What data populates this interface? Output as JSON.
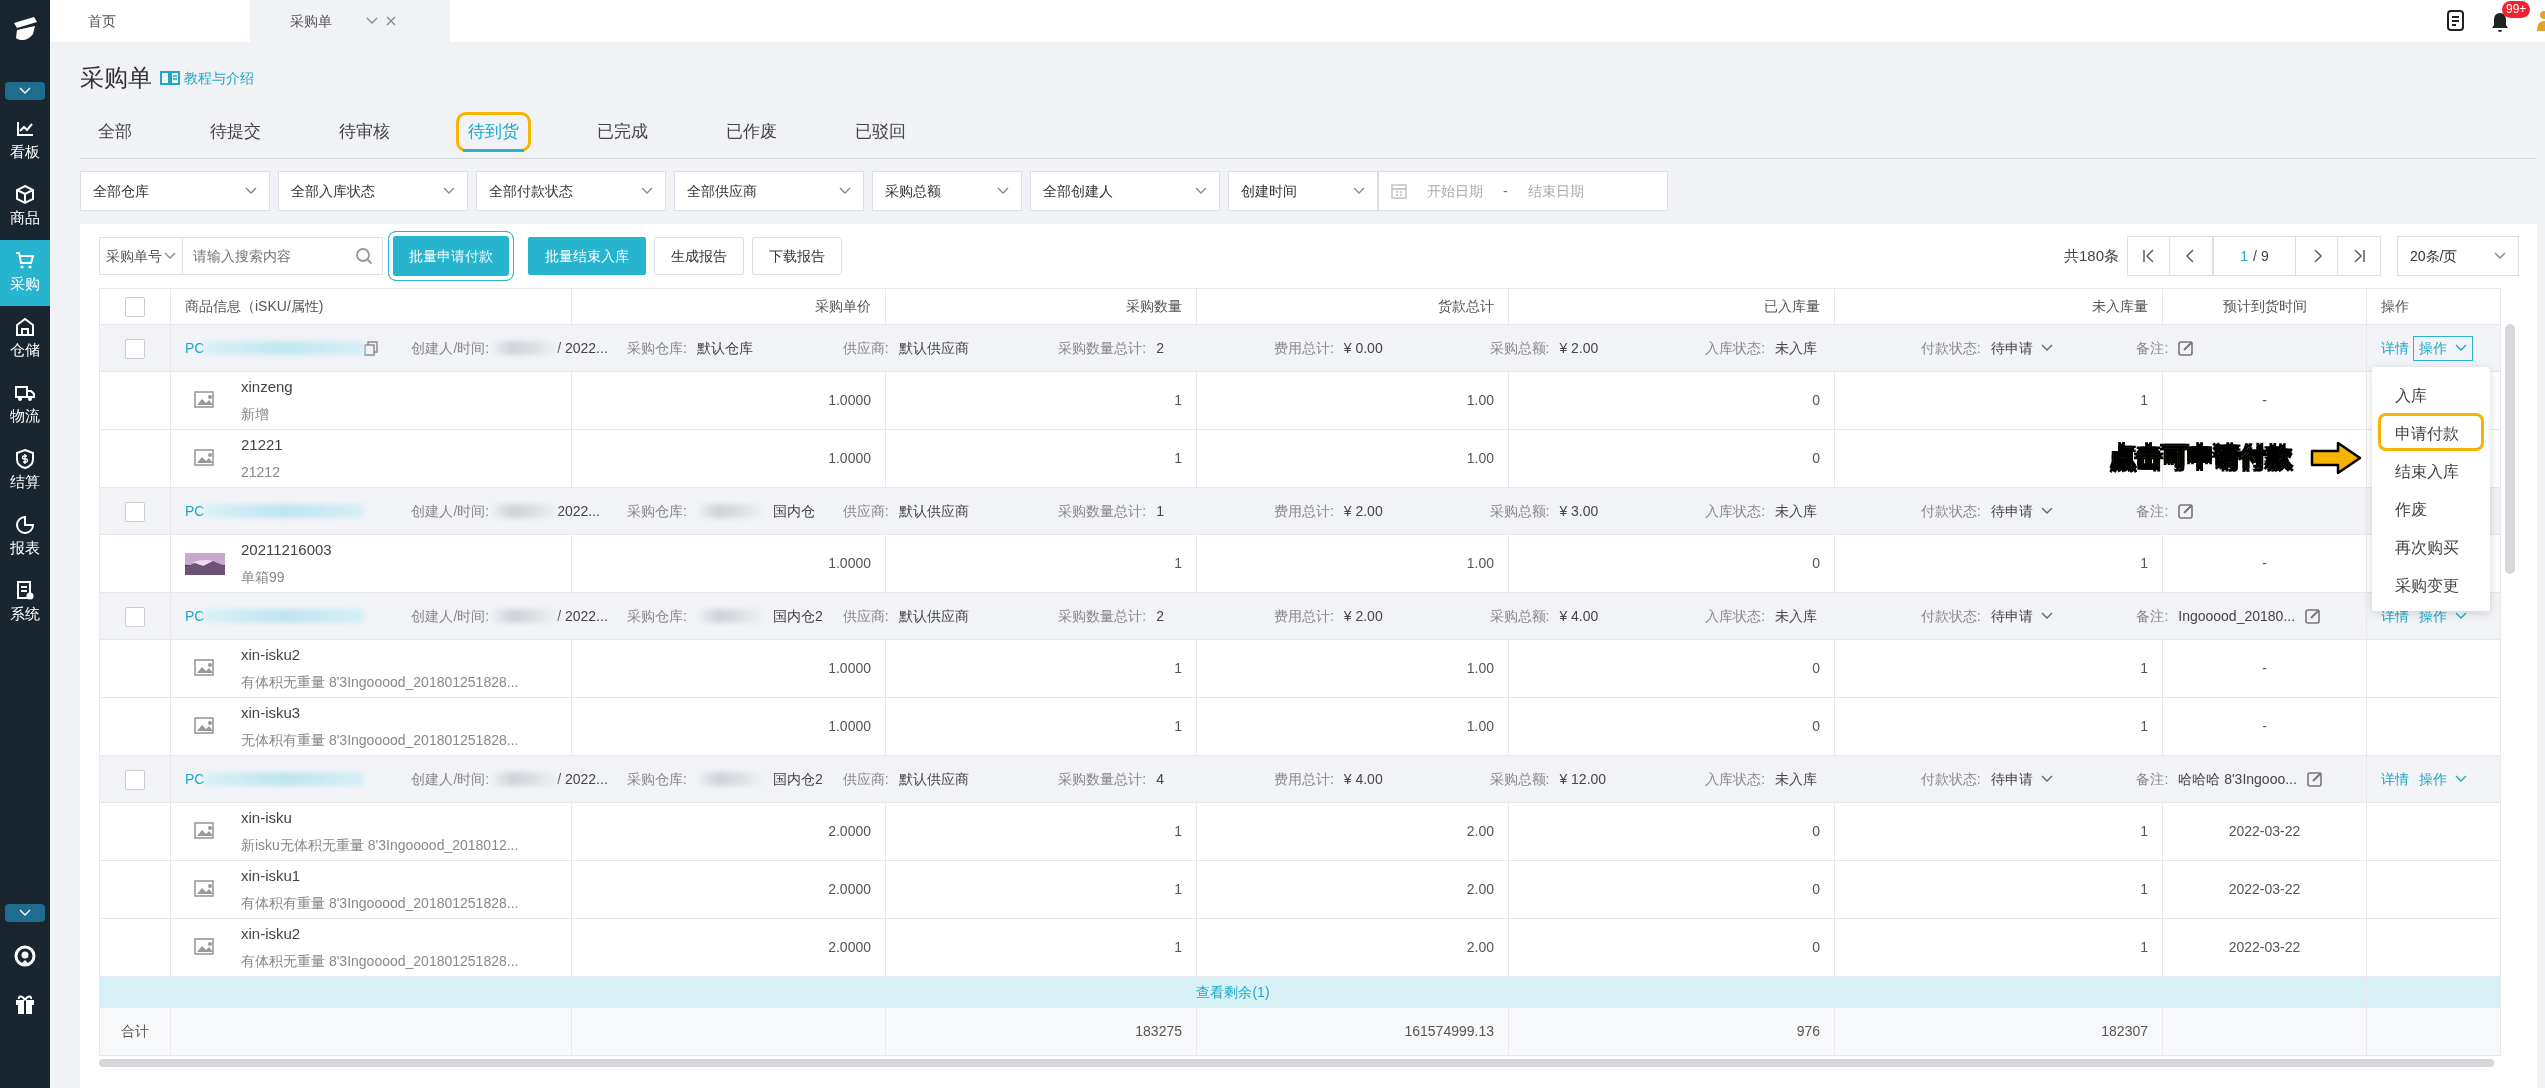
{
  "top_tabs": [
    {
      "label": "首页",
      "selected": false,
      "closable": false
    },
    {
      "label": "采购单",
      "selected": true,
      "closable": true
    }
  ],
  "header": {
    "notification_badge": "99+"
  },
  "sidebar": {
    "items": [
      {
        "label": "看板",
        "selected": false
      },
      {
        "label": "商品",
        "selected": false
      },
      {
        "label": "采购",
        "selected": true
      },
      {
        "label": "仓储",
        "selected": false
      },
      {
        "label": "物流",
        "selected": false
      },
      {
        "label": "结算",
        "selected": false
      },
      {
        "label": "报表",
        "selected": false
      },
      {
        "label": "系统",
        "selected": false
      }
    ]
  },
  "page": {
    "title": "采购单",
    "help_link": "教程与介绍"
  },
  "status_tabs": [
    {
      "label": "全部",
      "selected": false,
      "highlighted": false
    },
    {
      "label": "待提交",
      "selected": false,
      "highlighted": false
    },
    {
      "label": "待审核",
      "selected": false,
      "highlighted": false
    },
    {
      "label": "待到货",
      "selected": true,
      "highlighted": true
    },
    {
      "label": "已完成",
      "selected": false,
      "highlighted": false
    },
    {
      "label": "已作废",
      "selected": false,
      "highlighted": false
    },
    {
      "label": "已驳回",
      "selected": false,
      "highlighted": false
    }
  ],
  "filters": [
    {
      "label": "全部仓库",
      "kind": "wide"
    },
    {
      "label": "全部入库状态",
      "kind": "wide"
    },
    {
      "label": "全部付款状态",
      "kind": "wide"
    },
    {
      "label": "全部供应商",
      "kind": "wide"
    },
    {
      "label": "采购总额",
      "kind": "narrow"
    },
    {
      "label": "全部创建人",
      "kind": "wide"
    },
    {
      "label": "创建时间",
      "kind": "narrow"
    }
  ],
  "date_range": {
    "start_placeholder": "开始日期",
    "separator": "-",
    "end_placeholder": "结束日期"
  },
  "toolbar": {
    "search_type": "采购单号",
    "search_placeholder": "请输入搜索内容",
    "buttons": [
      {
        "label": "批量申请付款",
        "kind": "primary",
        "highlighted": true
      },
      {
        "label": "批量结束入库",
        "kind": "primary",
        "highlighted": false
      },
      {
        "label": "生成报告",
        "kind": "outline",
        "highlighted": false
      },
      {
        "label": "下载报告",
        "kind": "outline",
        "highlighted": false
      }
    ],
    "total": "共180条",
    "page": "1",
    "pages": "/ 9",
    "page_size": "20条/页"
  },
  "table": {
    "header_checked": false,
    "columns": [
      "商品信息（iSKU/属性)",
      "采购单价",
      "采购数量",
      "货款总计",
      "已入库量",
      "未入库量",
      "预计到货时间",
      "操作"
    ],
    "groups": [
      {
        "checked": false,
        "po": "PC",
        "show_copy": true,
        "menu_open": true,
        "fields": [
          {
            "label": "创建人/时间:",
            "value": "/ 2022...",
            "redacted": true,
            "kind": "text"
          },
          {
            "label": "采购仓库:",
            "value": "默认仓库",
            "redacted": false,
            "kind": "text"
          },
          {
            "label": "供应商:",
            "value": "默认供应商",
            "redacted": false,
            "kind": "text"
          },
          {
            "label": "采购数量总计:",
            "value": "2",
            "redacted": false,
            "kind": "text"
          },
          {
            "label": "费用总计:",
            "value": "¥ 0.00",
            "redacted": false,
            "kind": "text"
          },
          {
            "label": "采购总额:",
            "value": "¥ 2.00",
            "redacted": false,
            "kind": "text"
          },
          {
            "label": "入库状态:",
            "value": "未入库",
            "redacted": false,
            "kind": "text"
          },
          {
            "label": "付款状态:",
            "value": "待申请",
            "redacted": false,
            "kind": "dropdown"
          },
          {
            "label": "备注:",
            "redacted": false,
            "kind": "remark"
          }
        ],
        "actions": [
          {
            "label": "详情",
            "kind": "link"
          },
          {
            "label": "操作",
            "kind": "menu"
          }
        ],
        "items": [
          {
            "name": "xinzeng",
            "attribute": "新增",
            "kind": "placeholder",
            "values": [
              "1.0000",
              "1",
              "1.00",
              "0",
              "1",
              "-"
            ]
          },
          {
            "name": "21221",
            "attribute": "21212",
            "kind": "placeholder",
            "values": [
              "1.0000",
              "1",
              "1.00",
              "0"
            ]
          }
        ]
      },
      {
        "checked": false,
        "po": "PC",
        "show_copy": false,
        "fields": [
          {
            "label": "创建人/时间:",
            "value": "2022...",
            "redacted": true,
            "kind": "text"
          },
          {
            "label": "采购仓库:",
            "value": "国内仓",
            "redacted": true,
            "kind": "text"
          },
          {
            "label": "供应商:",
            "value": "默认供应商",
            "redacted": false,
            "kind": "text"
          },
          {
            "label": "采购数量总计:",
            "value": "1",
            "redacted": false,
            "kind": "text"
          },
          {
            "label": "费用总计:",
            "value": "¥ 2.00",
            "redacted": false,
            "kind": "text"
          },
          {
            "label": "采购总额:",
            "value": "¥ 3.00",
            "redacted": false,
            "kind": "text"
          },
          {
            "label": "入库状态:",
            "value": "未入库",
            "redacted": false,
            "kind": "text"
          },
          {
            "label": "付款状态:",
            "value": "待申请",
            "redacted": false,
            "kind": "dropdown"
          },
          {
            "label": "备注:",
            "redacted": false,
            "kind": "remark"
          }
        ],
        "items": [
          {
            "name": "20211216003",
            "attribute": "单箱99",
            "values": [
              "1.0000",
              "1",
              "1.00",
              "0",
              "1",
              "-"
            ]
          }
        ]
      },
      {
        "checked": false,
        "po": "PC",
        "show_copy": false,
        "menu_open": false,
        "fields": [
          {
            "label": "创建人/时间:",
            "value": "/ 2022...",
            "redacted": true,
            "kind": "text"
          },
          {
            "label": "采购仓库:",
            "value": "国内仓2",
            "redacted": true,
            "kind": "text"
          },
          {
            "label": "供应商:",
            "value": "默认供应商",
            "redacted": false,
            "kind": "text"
          },
          {
            "label": "采购数量总计:",
            "value": "2",
            "redacted": false,
            "kind": "text"
          },
          {
            "label": "费用总计:",
            "value": "¥ 2.00",
            "redacted": false,
            "kind": "text"
          },
          {
            "label": "采购总额:",
            "value": "¥ 4.00",
            "redacted": false,
            "kind": "text"
          },
          {
            "label": "入库状态:",
            "value": "未入库",
            "redacted": false,
            "kind": "text"
          },
          {
            "label": "付款状态:",
            "value": "待申请",
            "redacted": false,
            "kind": "dropdown"
          },
          {
            "label": "备注:",
            "value": "Ingooood_20180...",
            "redacted": false,
            "kind": "remark"
          }
        ],
        "actions": [
          {
            "label": "详情",
            "kind": "link"
          },
          {
            "label": "操作",
            "kind": "menu"
          }
        ],
        "items": [
          {
            "name": "xin-isku2",
            "attribute": "有体积无重量 8'3Ingooood_201801251828...",
            "kind": "placeholder",
            "values": [
              "1.0000",
              "1",
              "1.00",
              "0",
              "1",
              "-"
            ]
          },
          {
            "name": "xin-isku3",
            "attribute": "无体积有重量 8'3Ingooood_201801251828...",
            "kind": "placeholder",
            "values": [
              "1.0000",
              "1",
              "1.00",
              "0",
              "1",
              "-"
            ]
          }
        ]
      },
      {
        "checked": false,
        "po": "PC",
        "show_copy": false,
        "menu_open": false,
        "fields": [
          {
            "label": "创建人/时间:",
            "value": "/ 2022...",
            "redacted": true,
            "kind": "text"
          },
          {
            "label": "采购仓库:",
            "value": "国内仓2",
            "redacted": true,
            "kind": "text"
          },
          {
            "label": "供应商:",
            "value": "默认供应商",
            "redacted": false,
            "kind": "text"
          },
          {
            "label": "采购数量总计:",
            "value": "4",
            "redacted": false,
            "kind": "text"
          },
          {
            "label": "费用总计:",
            "value": "¥ 4.00",
            "redacted": false,
            "kind": "text"
          },
          {
            "label": "采购总额:",
            "value": "¥ 12.00",
            "redacted": false,
            "kind": "text"
          },
          {
            "label": "入库状态:",
            "value": "未入库",
            "redacted": false,
            "kind": "text"
          },
          {
            "label": "付款状态:",
            "value": "待申请",
            "redacted": false,
            "kind": "dropdown"
          },
          {
            "label": "备注:",
            "value": "哈哈哈 8'3Ingooo...",
            "redacted": false,
            "kind": "remark"
          }
        ],
        "actions": [
          {
            "label": "详情",
            "kind": "link"
          },
          {
            "label": "操作",
            "kind": "menu"
          }
        ],
        "items": [
          {
            "name": "xin-isku",
            "attribute": "新isku无体积无重量 8'3Ingooood_2018012...",
            "kind": "placeholder",
            "values": [
              "2.0000",
              "1",
              "2.00",
              "0",
              "1",
              "2022-03-22"
            ]
          },
          {
            "name": "xin-isku1",
            "attribute": "有体积有重量 8'3Ingooood_201801251828...",
            "kind": "placeholder",
            "values": [
              "2.0000",
              "1",
              "2.00",
              "0",
              "1",
              "2022-03-22"
            ]
          },
          {
            "name": "xin-isku2",
            "attribute": "有体积无重量 8'3Ingooood_201801251828...",
            "kind": "placeholder",
            "values": [
              "2.0000",
              "1",
              "2.00",
              "0",
              "1",
              "2022-03-22"
            ]
          }
        ]
      }
    ],
    "more": "查看剩余(1)",
    "totals": {
      "label": "合计",
      "values": [
        "183275",
        "161574999.13",
        "976",
        "182307"
      ]
    }
  },
  "dropdown": {
    "items": [
      {
        "label": "入库",
        "highlighted": false
      },
      {
        "label": "申请付款",
        "highlighted": true
      },
      {
        "label": "结束入库",
        "highlighted": false
      },
      {
        "label": "作废",
        "highlighted": false
      },
      {
        "label": "再次购买",
        "highlighted": false
      },
      {
        "label": "采购变更",
        "highlighted": false
      }
    ]
  },
  "annotation": {
    "text": "点击可申请付款"
  }
}
